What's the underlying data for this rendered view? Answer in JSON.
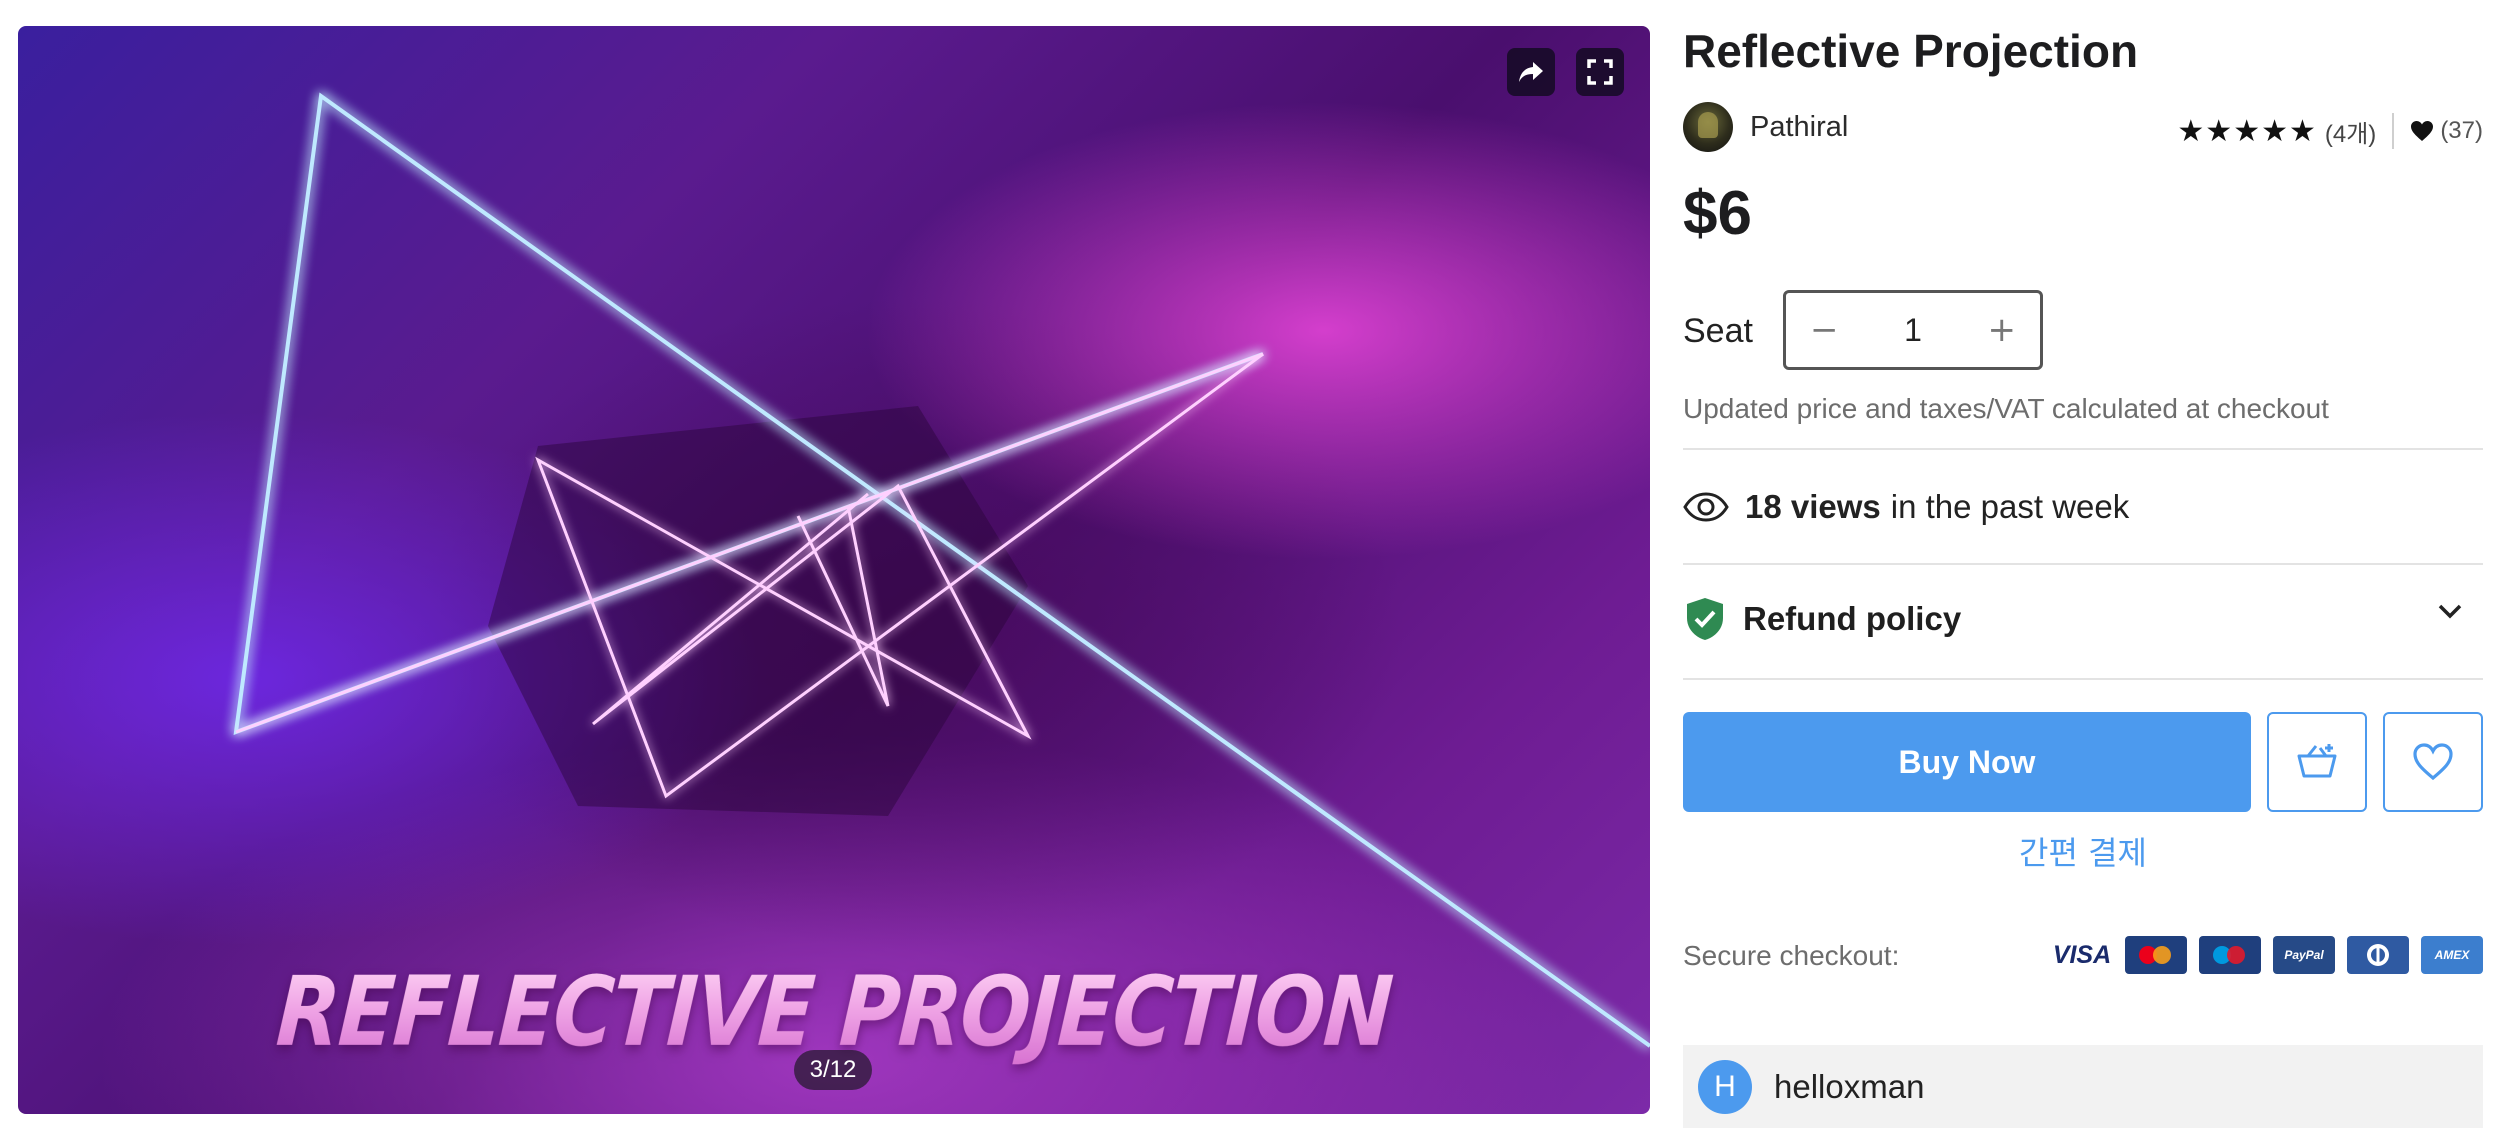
{
  "gallery": {
    "slide_title": "REFLECTIVE PROJECTION",
    "counter": "3/12",
    "share_icon": "share-arrow-icon",
    "fullscreen_icon": "fullscreen-icon"
  },
  "product": {
    "title": "Reflective Projection",
    "seller": "Pathiral",
    "rating_stars": 5,
    "rating_count": "(4개)",
    "likes": "(37)",
    "price": "$6",
    "seat_label": "Seat",
    "seat_value": "1",
    "decrement": "−",
    "increment": "+",
    "price_note": "Updated price and taxes/VAT calculated at checkout"
  },
  "views": {
    "bold": "18 views",
    "rest": "in the past week"
  },
  "refund": {
    "label": "Refund policy"
  },
  "actions": {
    "buy_now": "Buy Now",
    "quick_pay": "간편 결제"
  },
  "checkout": {
    "label": "Secure checkout:",
    "cards": [
      "VISA",
      "Mastercard",
      "Maestro",
      "PayPal",
      "Diners",
      "AMEX"
    ]
  },
  "user": {
    "initial": "H",
    "name": "helloxman"
  },
  "colors": {
    "accent": "#4c9aee",
    "shield": "#2f8a52"
  }
}
